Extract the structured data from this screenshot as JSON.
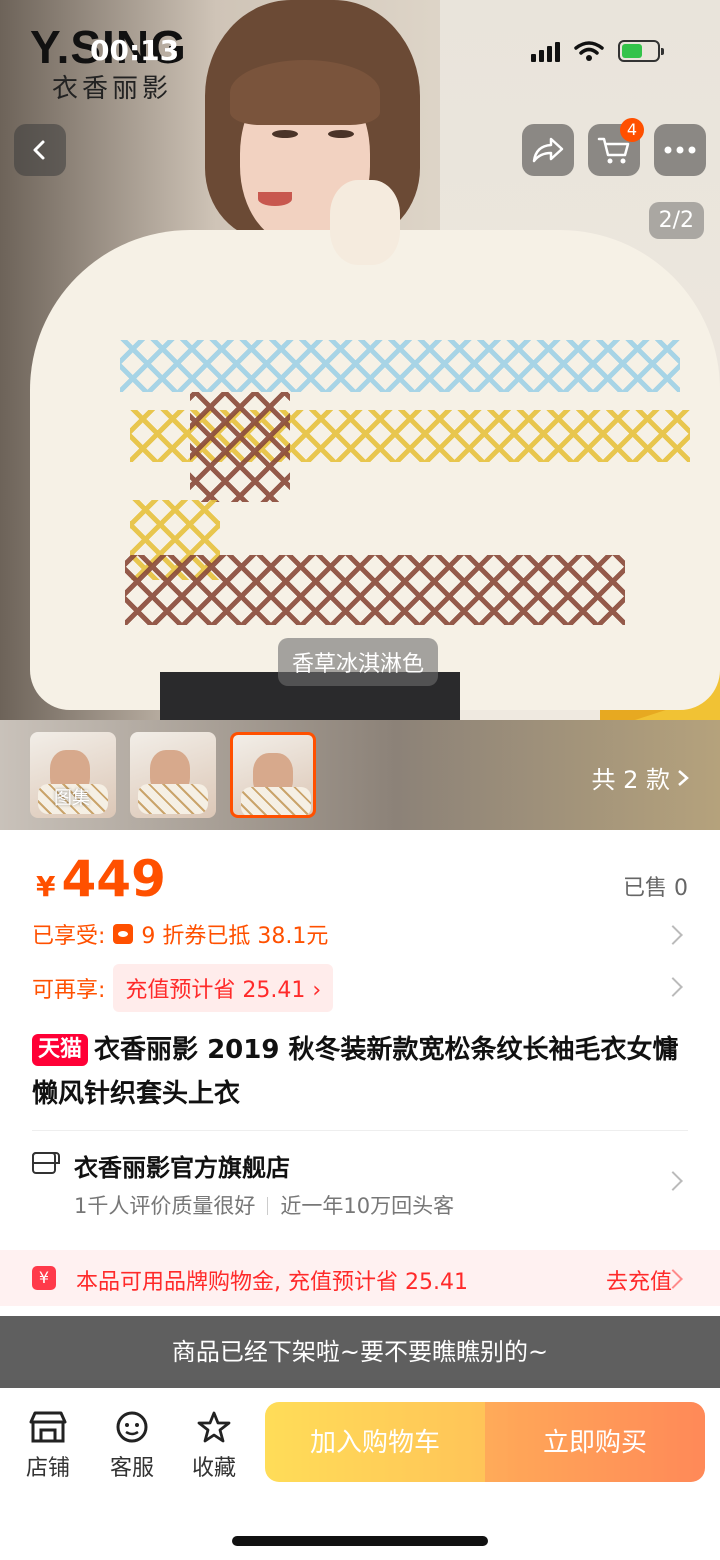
{
  "status_bar": {
    "time": "00:13",
    "battery_percent": 60,
    "battery_color": "#33c34a"
  },
  "brand": {
    "en": "Y.SING",
    "cn": "衣香丽影"
  },
  "header": {
    "cart_count": "4",
    "image_index": "2/2"
  },
  "hero": {
    "color_label": "香草冰淇淋色"
  },
  "thumbnails": {
    "first_label": "图集",
    "variant_count": "共 2 款",
    "selected_index": 3
  },
  "price": {
    "currency": "¥",
    "value": "449",
    "sold": "已售 0"
  },
  "promotions": {
    "enjoyed_label": "已享受:",
    "enjoyed_value": "9 折券已抵 38.1元",
    "more_label": "可再享:",
    "more_value": "充值预计省 25.41 ›"
  },
  "product": {
    "tmall_tag": "天猫",
    "title": "衣香丽影 2019 秋冬装新款宽松条纹长袖毛衣女慵懒风针织套头上衣"
  },
  "shop": {
    "name": "衣香丽影官方旗舰店",
    "stat1": "1千人评价质量很好",
    "stat2": "近一年10万回头客"
  },
  "recharge": {
    "icon": "¥",
    "text": "本品可用品牌购物金, 充值预计省 25.41",
    "link": "去充值"
  },
  "offline_notice": "商品已经下架啦~要不要瞧瞧别的~",
  "bottom_nav": {
    "store": "店铺",
    "service": "客服",
    "favorite": "收藏",
    "add_to_cart": "加入购物车",
    "buy_now": "立即购买"
  },
  "colors": {
    "accent": "#ff5000",
    "tmall": "#ff0036",
    "recharge_red": "#ff2a2a"
  }
}
